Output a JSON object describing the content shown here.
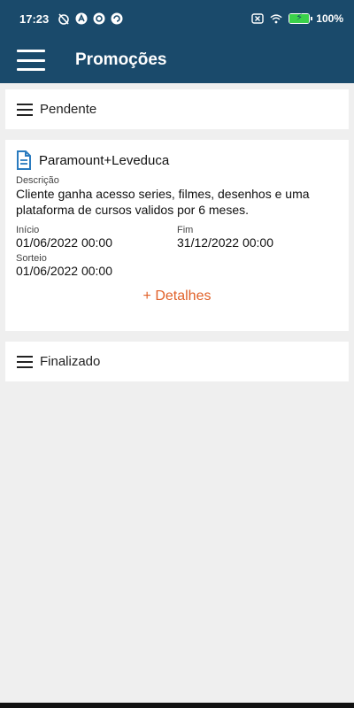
{
  "status_bar": {
    "time": "17:23",
    "battery": "100%",
    "icons": [
      "alarm-off-icon",
      "app-a-icon",
      "vpn-icon",
      "sync-icon",
      "sim-x-icon",
      "wifi-icon",
      "battery-charging-icon"
    ]
  },
  "app_bar": {
    "title": "Promoções",
    "menu_icon": "hamburger-menu-icon"
  },
  "sections": {
    "pending": {
      "label": "Pendente"
    },
    "finished": {
      "label": "Finalizado"
    }
  },
  "promotion": {
    "title": "Paramount+Leveduca",
    "description_label": "Descrição",
    "description": "Cliente ganha acesso series, filmes, desenhos e uma plataforma de cursos validos por 6 meses.",
    "start_label": "Início",
    "start_value": "01/06/2022 00:00",
    "end_label": "Fim",
    "end_value": "31/12/2022 00:00",
    "draw_label": "Sorteio",
    "draw_value": "01/06/2022 00:00",
    "details_link": "+ Detalhes"
  },
  "colors": {
    "brand": "#1a4a6b",
    "accent": "#e1622a",
    "background": "#efefef",
    "doc_icon": "#2a7bbf"
  }
}
